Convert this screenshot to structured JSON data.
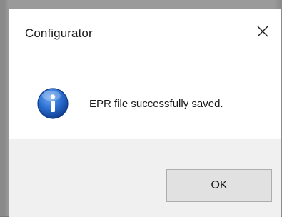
{
  "window": {
    "title": "Configurator",
    "close_icon": "close-icon"
  },
  "message": {
    "icon": "info-icon",
    "text": "EPR file successfully saved."
  },
  "buttons": {
    "ok_label": "OK"
  },
  "colors": {
    "info_blue": "#1f5fc4",
    "footer_bg": "#f0f0f0",
    "button_bg": "#e1e1e1"
  }
}
